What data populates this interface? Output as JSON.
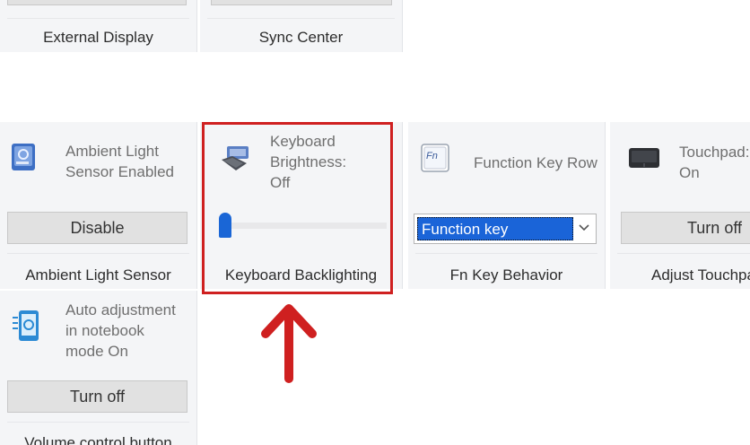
{
  "top_row": {
    "external_display_label": "External Display",
    "sync_center_label": "Sync Center"
  },
  "ambient": {
    "status_text": "Ambient Light\nSensor Enabled",
    "button_label": "Disable",
    "tile_label": "Ambient Light Sensor",
    "icon": "ambient-light-sensor-icon"
  },
  "keyboard": {
    "status_text": "Keyboard\nBrightness:\nOff",
    "slider_level": 0,
    "tile_label": "Keyboard Backlighting",
    "icon": "keyboard-backlight-icon"
  },
  "fn": {
    "icon_text": "Fn",
    "title": "Function Key Row",
    "select_value": "Function key",
    "tile_label": "Fn Key Behavior"
  },
  "touchpad": {
    "status_text": "Touchpad:\nOn",
    "button_label": "Turn off",
    "tile_label": "Adjust Touchpad",
    "icon": "touchpad-icon"
  },
  "volume": {
    "status_text": "Auto adjustment\nin notebook\nmode On",
    "button_label": "Turn off",
    "tile_label": "Volume control button",
    "icon": "volume-control-icon"
  },
  "colors": {
    "highlight": "#cf2020",
    "accent": "#1a66d6",
    "tile_bg": "#f4f5f7"
  }
}
